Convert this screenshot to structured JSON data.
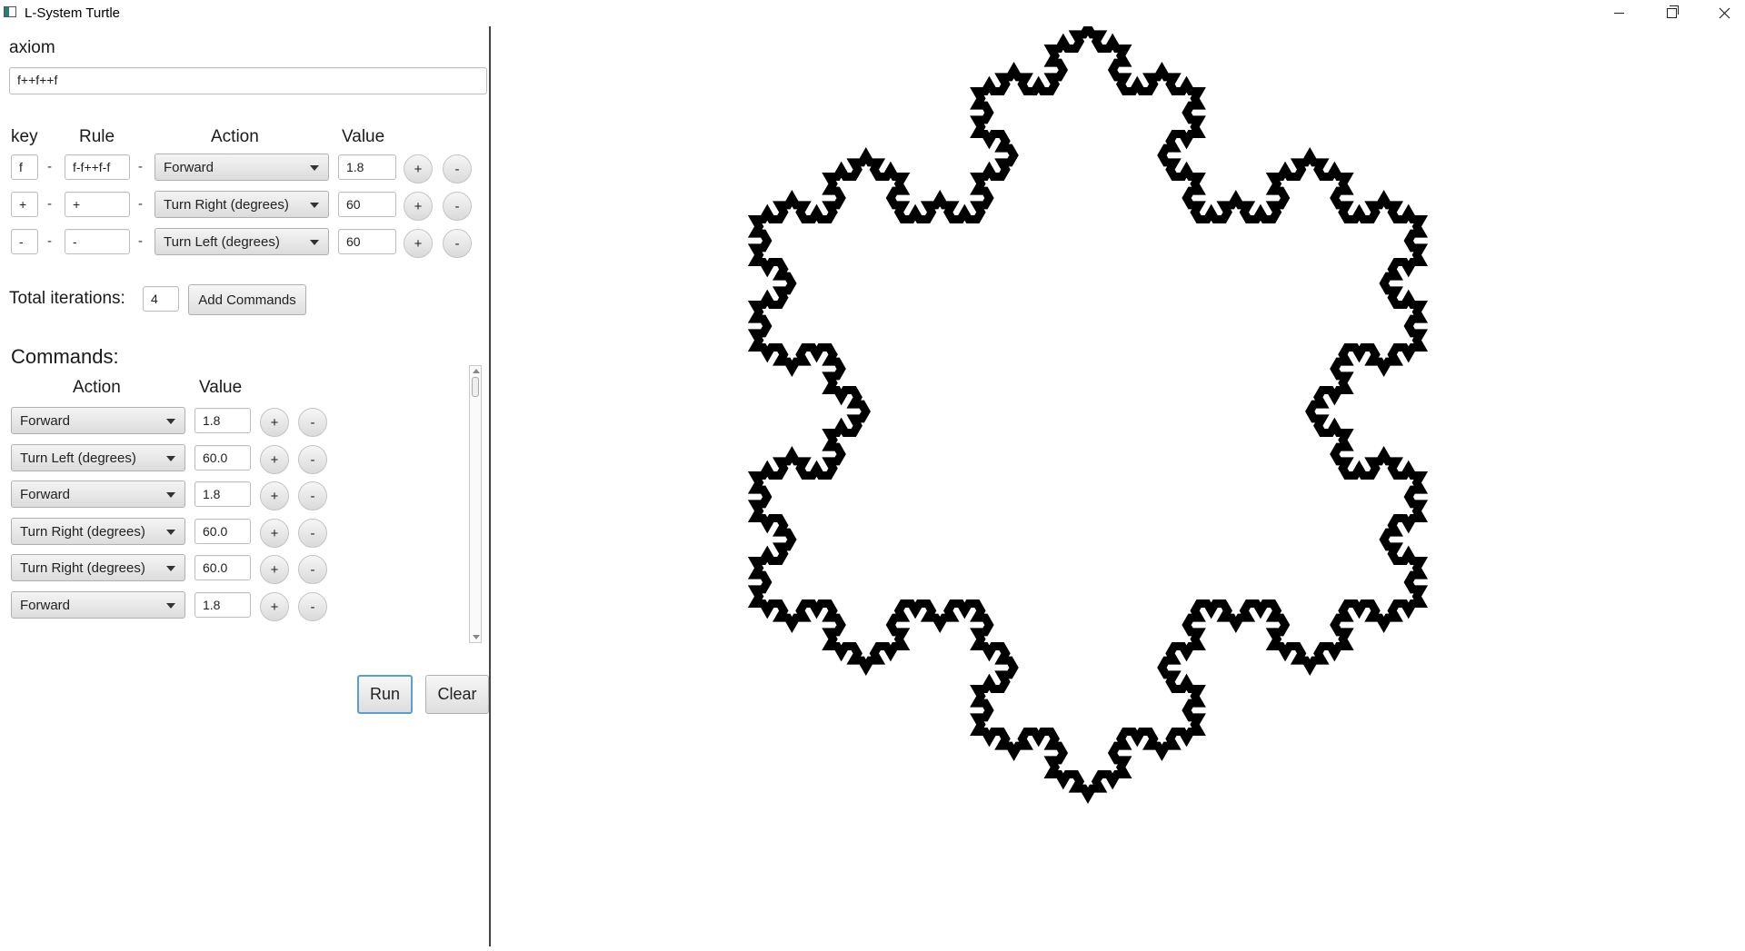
{
  "window": {
    "title": "L-System Turtle",
    "minimize_icon": "minimize-icon",
    "maximize_icon": "restore-icon",
    "close_icon": "close-icon"
  },
  "axiom": {
    "label": "axiom",
    "value": "f++f++f"
  },
  "rules_header": {
    "key": "key",
    "rule": "Rule",
    "action": "Action",
    "value": "Value"
  },
  "rules": [
    {
      "key": "f",
      "rule": "f-f++f-f",
      "action": "Forward",
      "value": "1.8"
    },
    {
      "key": "+",
      "rule": "+",
      "action": "Turn Right (degrees)",
      "value": "60"
    },
    {
      "key": "-",
      "rule": "-",
      "action": "Turn Left (degrees)",
      "value": "60"
    }
  ],
  "separator": "-",
  "plus_label": "+",
  "minus_label": "-",
  "iterations": {
    "label": "Total iterations:",
    "value": "4",
    "add_button": "Add Commands"
  },
  "commands": {
    "title": "Commands:",
    "action_header": "Action",
    "value_header": "Value",
    "rows": [
      {
        "action": "Forward",
        "value": "1.8"
      },
      {
        "action": "Turn Left (degrees)",
        "value": "60.0"
      },
      {
        "action": "Forward",
        "value": "1.8"
      },
      {
        "action": "Turn Right (degrees)",
        "value": "60.0"
      },
      {
        "action": "Turn Right (degrees)",
        "value": "60.0"
      },
      {
        "action": "Forward",
        "value": "1.8"
      }
    ]
  },
  "buttons": {
    "run": "Run",
    "clear": "Clear"
  },
  "drawing": {
    "iterations": 4,
    "stroke_color": "#000000"
  }
}
